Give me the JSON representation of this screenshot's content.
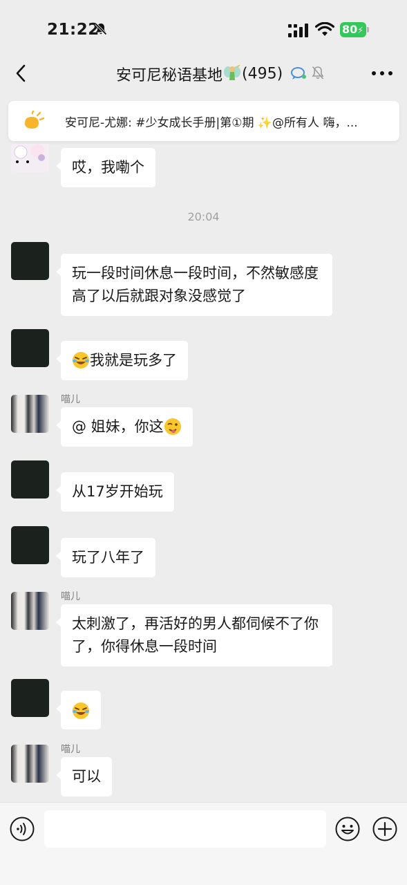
{
  "status": {
    "time": "21:22",
    "battery": "80"
  },
  "nav": {
    "title": "安可尼秘语基地",
    "count": "(495)"
  },
  "notice": {
    "text": "安可尼-尤娜: #少女成长手册|第①期 ✨@所有人  嗨，..."
  },
  "messages": [
    {
      "sender": "",
      "text": "哎，我嘞个"
    },
    {
      "timestamp": "20:04"
    },
    {
      "sender": "",
      "text": "玩一段时间休息一段时间，不然敏感度高了以后就跟对象没感觉了"
    },
    {
      "sender": "",
      "text": "我就是玩多了"
    },
    {
      "sender": "喵儿",
      "text": "@ 姐妹，你这"
    },
    {
      "sender": "",
      "text": "从17岁开始玩"
    },
    {
      "sender": "",
      "text": "玩了八年了"
    },
    {
      "sender": "喵儿",
      "text": "太刺激了，再活好的男人都伺候不了你了，你得休息一段时间"
    },
    {
      "sender": "",
      "text": ""
    },
    {
      "sender": "喵儿",
      "text": "可以"
    }
  ],
  "input": {
    "placeholder": ""
  },
  "icons": {
    "mute": "bell-slash-icon",
    "signal": "signal-icon",
    "wifi": "wifi-icon",
    "back": "chevron-left-icon",
    "fairy": "fairy-emoji-icon",
    "chat": "chat-bubble-icon",
    "bell": "bell-slash-icon",
    "more": "more-dots-icon",
    "notice": "sun-announcement-icon",
    "voice": "voice-icon",
    "emoji": "smiley-icon",
    "plus": "plus-icon",
    "laugh_cry": "rolling-laughing-emoji-icon",
    "wink": "wink-tongue-emoji-icon"
  },
  "colors": {
    "background": "#ededed",
    "bubble": "#ffffff",
    "battery": "#34c759",
    "timestamp": "#a0a0a0"
  }
}
